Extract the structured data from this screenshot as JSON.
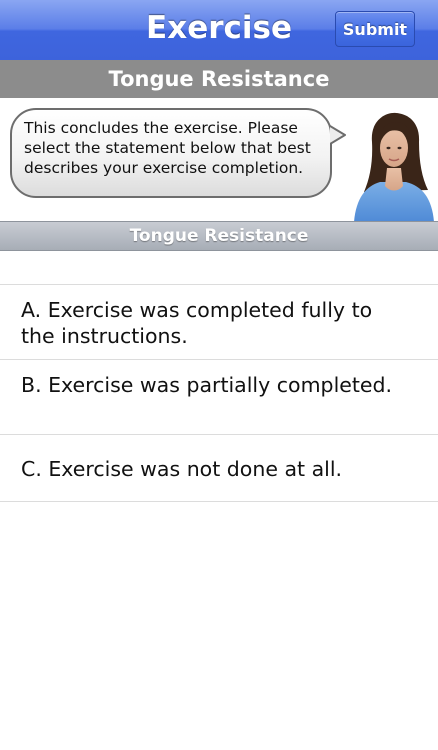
{
  "navbar": {
    "title": "Exercise",
    "submit_label": "Submit"
  },
  "section_title": "Tongue Resistance",
  "intro": {
    "message": "This concludes the exercise. Please select the statement below that best describes your exercise completion."
  },
  "subheader_title": "Tongue Resistance",
  "options": [
    {
      "label": "A. Exercise was completed fully to the instructions."
    },
    {
      "label": "B. Exercise was partially completed."
    },
    {
      "label": "C. Exercise was not done at all."
    }
  ],
  "colors": {
    "navbar": "#4a6fe3",
    "section_header": "#8c8c8c",
    "subheader": "#b4b9c1"
  },
  "icons": {
    "avatar": "instructor-portrait"
  }
}
